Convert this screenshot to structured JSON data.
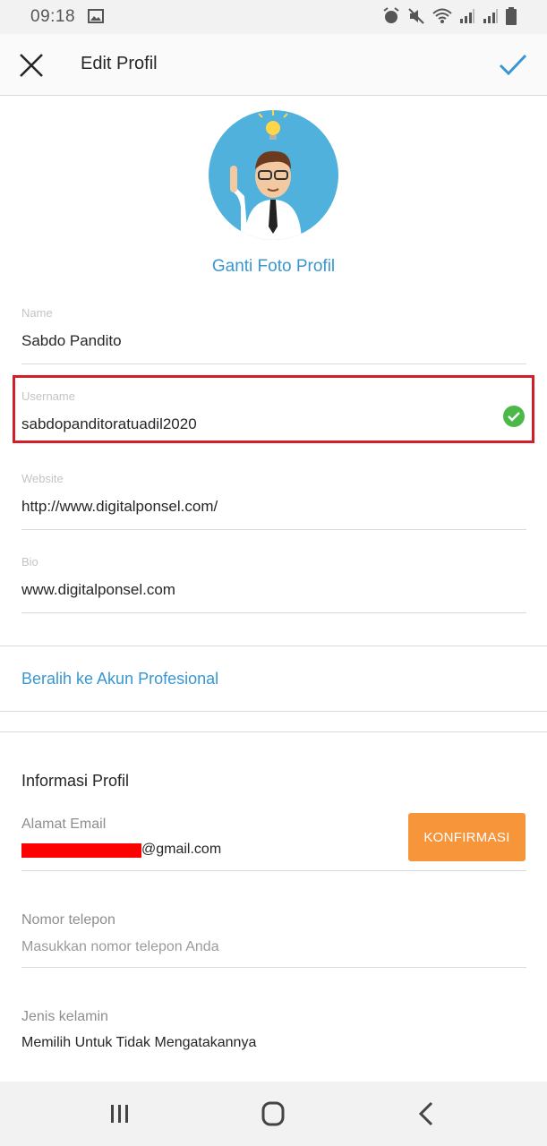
{
  "status": {
    "time": "09:18",
    "icons": [
      "gallery-icon",
      "alarm-icon",
      "mute-icon",
      "wifi-icon",
      "signal-icon",
      "signal-icon",
      "battery-icon"
    ]
  },
  "header": {
    "title": "Edit Profil",
    "close_icon": "close-icon",
    "confirm_icon": "check-icon"
  },
  "profile": {
    "change_photo_label": "Ganti Foto Profil"
  },
  "fields": {
    "name": {
      "label": "Name",
      "value": "Sabdo Pandito"
    },
    "username": {
      "label": "Username",
      "value": "sabdopanditoratuadil2020",
      "valid_icon": "check-circle-icon"
    },
    "website": {
      "label": "Website",
      "value": "http://www.digitalponsel.com/"
    },
    "bio": {
      "label": "Bio",
      "value": "www.digitalponsel.com"
    }
  },
  "professional_link": "Beralih ke Akun Profesional",
  "profile_info": {
    "title": "Informasi Profil",
    "email_label": "Alamat Email",
    "email_value_visible": "@gmail.com",
    "confirm_button": "KONFIRMASI",
    "phone_label": "Nomor telepon",
    "phone_placeholder": "Masukkan nomor telepon Anda",
    "gender_label": "Jenis kelamin",
    "gender_value": "Memilih Untuk Tidak Mengatakannya"
  },
  "colors": {
    "accent_blue": "#3897d1",
    "highlight_red": "#d11f2a",
    "confirm_orange": "#f7953b",
    "valid_green": "#4cb848"
  },
  "nav": {
    "recent_icon": "recent-apps-icon",
    "home_icon": "home-icon",
    "back_icon": "back-icon"
  }
}
